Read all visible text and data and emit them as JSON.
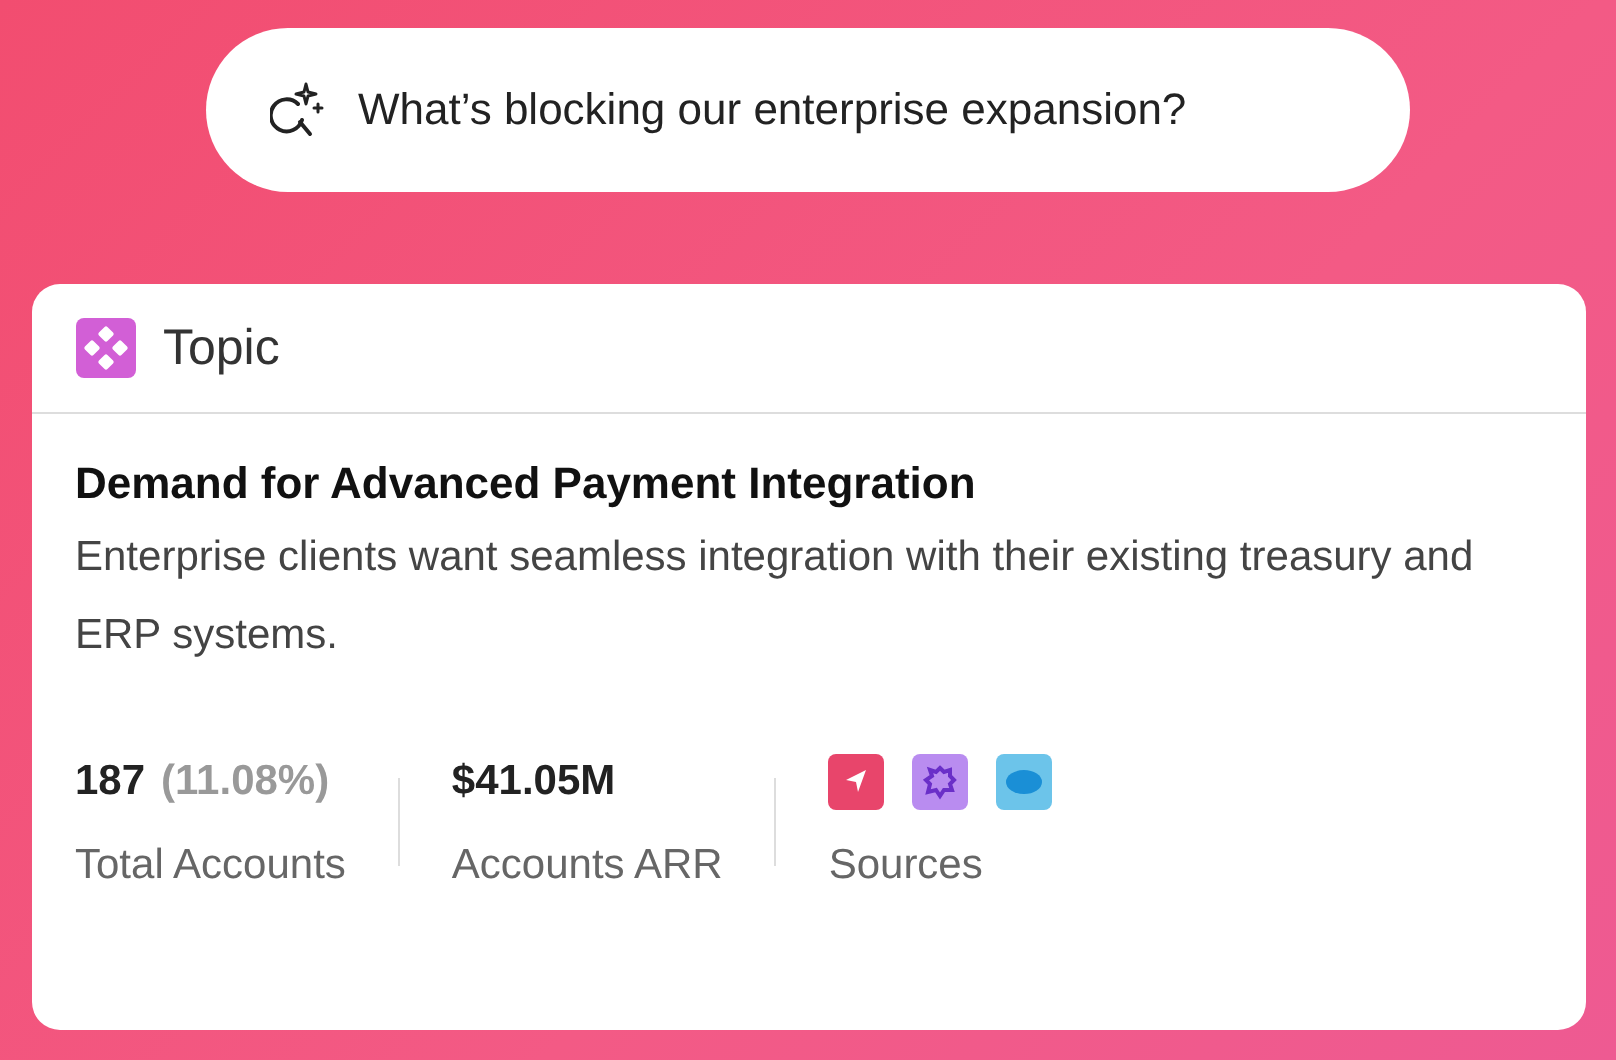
{
  "query": {
    "text": "What’s blocking our enterprise expansion?"
  },
  "card": {
    "type_label": "Topic",
    "title": "Demand for Advanced Payment Integration",
    "description": "Enterprise clients want seamless integration with their existing treasury and ERP systems.",
    "stats": [
      {
        "kind": "count",
        "value": "187",
        "extra": "(11.08%)",
        "label": "Total Accounts"
      },
      {
        "kind": "value",
        "value": "$41.05M",
        "label": "Accounts ARR"
      },
      {
        "kind": "sources",
        "label": "Sources",
        "sources": [
          {
            "color": "#e8456b"
          },
          {
            "color": "#b98cf0"
          },
          {
            "color": "#6cc4ea"
          }
        ]
      }
    ]
  }
}
